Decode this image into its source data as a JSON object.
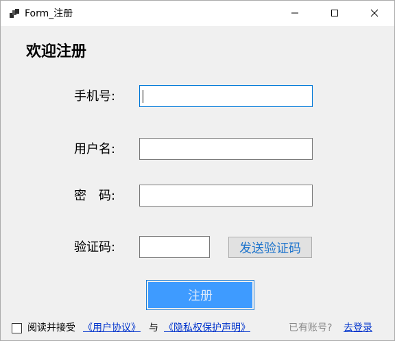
{
  "window": {
    "title": "Form_注册",
    "icons": {
      "app": "window-app-icon",
      "minimize": "minimize-icon",
      "maximize": "maximize-icon",
      "close": "close-icon"
    }
  },
  "form": {
    "heading": "欢迎注册",
    "phone_label": "手机号:",
    "phone_value": "",
    "username_label": "用户名:",
    "username_value": "",
    "password_label": "密　码:",
    "password_value": "",
    "code_label": "验证码:",
    "code_value": "",
    "send_code_button": "发送验证码",
    "register_button": "注册"
  },
  "footer": {
    "agree_checked": false,
    "agree_text": "阅读并接受",
    "user_agreement_link": "《用户协议》",
    "and_text": "与",
    "privacy_link": "《隐私权保护声明》",
    "have_account_text": "已有账号?",
    "login_link": "去登录"
  },
  "colors": {
    "accent": "#0078d7",
    "register_bg": "#3e9bff",
    "link": "#0033cc"
  }
}
